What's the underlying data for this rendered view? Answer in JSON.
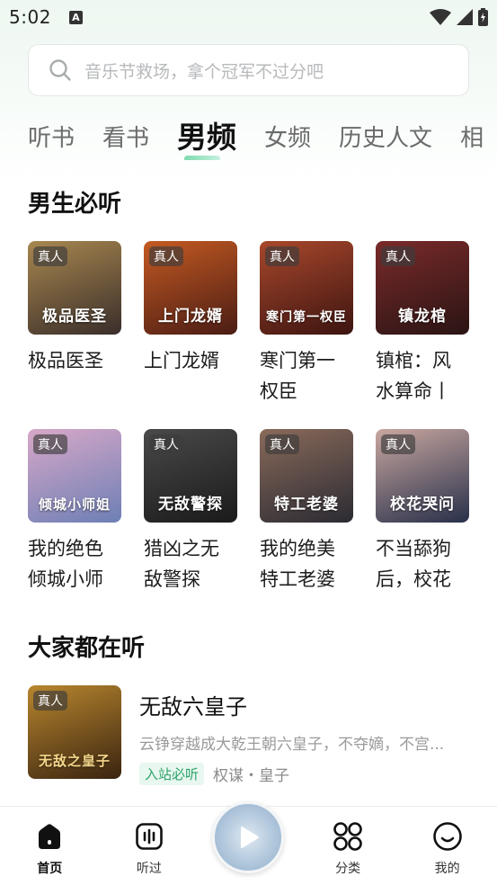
{
  "status_bar": {
    "time": "5:02",
    "notification_icon": "A"
  },
  "search": {
    "placeholder": "音乐节救场，拿个冠军不过分吧"
  },
  "tabs": [
    {
      "label": "听书",
      "active": false
    },
    {
      "label": "看书",
      "active": false
    },
    {
      "label": "男频",
      "active": true
    },
    {
      "label": "女频",
      "active": false
    },
    {
      "label": "历史人文",
      "active": false
    },
    {
      "label": "相",
      "active": false
    }
  ],
  "section_1": {
    "title": "男生必听",
    "books": [
      {
        "name": "极品医圣",
        "badge": "真人",
        "cover_text": "极品医圣",
        "colors": [
          "#3a2e2a",
          "#a8874f"
        ]
      },
      {
        "name": "上门龙婿",
        "badge": "真人",
        "cover_text": "上门龙婿",
        "colors": [
          "#4a1c14",
          "#c45a22"
        ]
      },
      {
        "name": "寒门第一权臣",
        "badge": "真人",
        "cover_text": "寒门第一权臣",
        "colors": [
          "#3d1410",
          "#a8482c"
        ]
      },
      {
        "name": "镇棺：风水算命丨",
        "badge": "真人",
        "cover_text": "镇龙棺",
        "colors": [
          "#2a1414",
          "#7a2a2a"
        ]
      },
      {
        "name": "我的绝色倾城小师",
        "badge": "真人",
        "cover_text": "倾城小师姐",
        "colors": [
          "#6d7fb5",
          "#d8a8c8"
        ]
      },
      {
        "name": "猎凶之无敌警探",
        "badge": "真人",
        "cover_text": "无敌警探",
        "colors": [
          "#1a1a1a",
          "#4a4a4a"
        ]
      },
      {
        "name": "我的绝美特工老婆",
        "badge": "真人",
        "cover_text": "特工老婆",
        "colors": [
          "#2b2b33",
          "#8a6a5a"
        ]
      },
      {
        "name": "不当舔狗后，校花",
        "badge": "真人",
        "cover_text": "校花哭问",
        "colors": [
          "#28304a",
          "#c9a7a0"
        ]
      }
    ]
  },
  "section_2": {
    "title": "大家都在听",
    "item": {
      "badge": "真人",
      "title": "无敌六皇子",
      "description": "云铮穿越成大乾王朝六皇子，不夺嫡，不宫...",
      "tag": "入站必听",
      "meta": "权谋・皇子",
      "cover_text": "无敌之皇子",
      "colors": [
        "#3a2410",
        "#b8862e"
      ]
    }
  },
  "bottom_nav": {
    "items": [
      {
        "label": "首页",
        "icon": "home-icon",
        "active": true
      },
      {
        "label": "听过",
        "icon": "listened-icon",
        "active": false
      },
      {
        "label": "分类",
        "icon": "category-icon",
        "active": false
      },
      {
        "label": "我的",
        "icon": "profile-icon",
        "active": false
      }
    ],
    "center": {
      "icon": "play-icon"
    }
  }
}
